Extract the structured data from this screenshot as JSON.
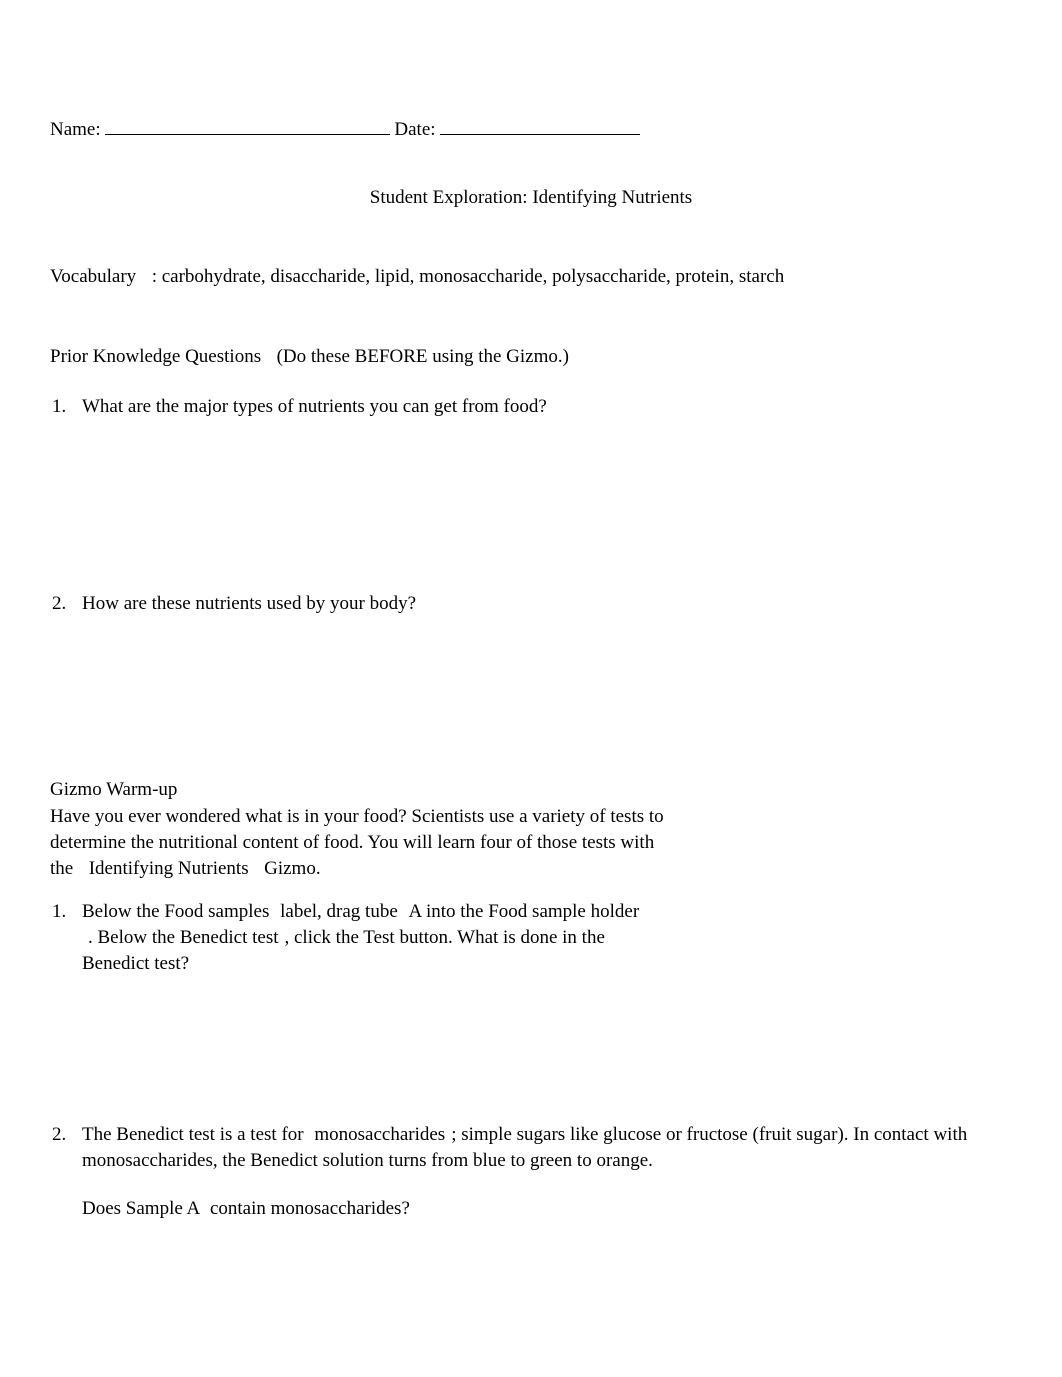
{
  "header": {
    "name_label": "Name: ",
    "date_label": "Date: "
  },
  "title": "Student Exploration: Identifying Nutrients",
  "vocabulary": {
    "label": "Vocabulary",
    "text": ": carbohydrate, disaccharide, lipid, monosaccharide, polysaccharide, protein, starch"
  },
  "prior": {
    "label": "Prior Knowledge Questions ",
    "note": "(Do these BEFORE using the Gizmo.)"
  },
  "pk_questions": [
    {
      "num": "1.",
      "text": "What are the major types of nutrients you can get from food?"
    },
    {
      "num": "2.",
      "text": "How are these nutrients used by your body?"
    }
  ],
  "warmup": {
    "heading": "Gizmo Warm-up",
    "para_pre": "Have you ever wondered what is in your food? Scientists use a variety of tests to determine the nutritional content of food. You will learn four of those tests with the ",
    "para_em1": "Identifying Nutrients",
    "para_post": " Gizmo."
  },
  "warmup_q1": {
    "num": "1.",
    "seg1": "Below the ",
    "food_samples": "Food samples ",
    "seg2": "label, drag tube ",
    "a": "A ",
    "seg3": "into the ",
    "food_sample": "Food sample ",
    "holder": "holder",
    "seg4": ". Below the ",
    "benedict": "Benedict test",
    "seg5": ", click the ",
    "test": "Test ",
    "seg6": "button. What is done in the Benedict test?"
  },
  "warmup_q2": {
    "num": "2.",
    "seg1": "The Benedict test is a test for ",
    "mono": "monosaccharides",
    "seg2": "; simple sugars like glucose or fructose (fruit sugar). In contact with monosaccharides, the Benedict solution turns from blue to green to orange."
  },
  "warmup_follow": {
    "seg1": "Does Sample ",
    "a": "A ",
    "seg2": "contain monosaccharides?"
  }
}
